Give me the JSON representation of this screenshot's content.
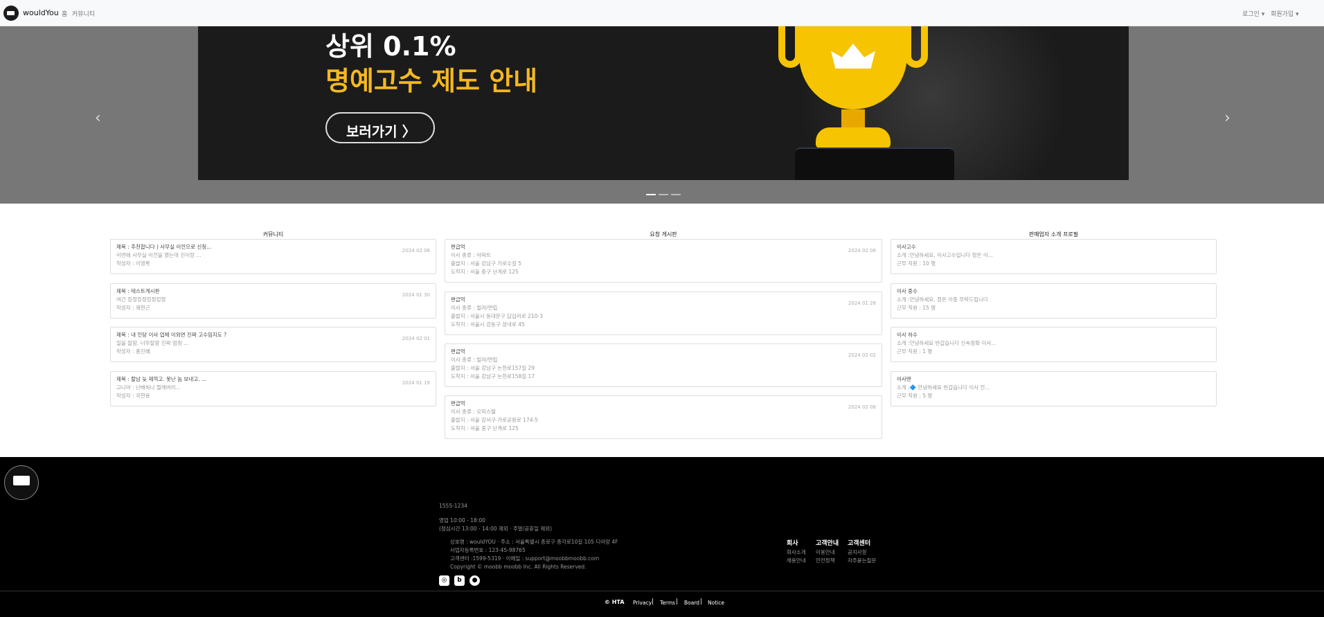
{
  "nav": {
    "brand": "wouldYou",
    "links": [
      "홈",
      "커뮤니티"
    ],
    "login": "로그인 ▾",
    "signup": "회원가입 ▾"
  },
  "carousel": {
    "line1": "상위 0.1%",
    "line2": "명예고수 제도 안내",
    "button": "보러가기  〉",
    "prev": "‹",
    "next": "›",
    "slides": 3,
    "active": 0
  },
  "community": {
    "title": "커뮤니티",
    "posts": [
      {
        "title": "제목 : 추천합니다 ) 사무실 이전으로 신청...",
        "body": "이번에 사무실 이전을 했는데 진이랑 ...",
        "author": "작성자 : 이영록",
        "date": "2024 02 08"
      },
      {
        "title": "제목 : 테스트게시판",
        "body": "여긴 킹정킹정킹정킹정",
        "author": "작성자 : 제현근",
        "date": "2024 01 30"
      },
      {
        "title": "제목 : 내 인당 이사 업체 이외면 진짜 고수임지도 ?",
        "body": "일을 잘함. 너무잘함 진짜 엄청 ...",
        "author": "작성자 : 홍진혜",
        "date": "2024 02 01"
      },
      {
        "title": "제목 : 할남 늦 제끽고. 못난 놈 보내고. ...",
        "body": "고니야 : 난배하나 필레버리...",
        "author": "작성자 : 국현용",
        "date": "2024 01 19"
      }
    ]
  },
  "requests": {
    "title": "요청 게시판",
    "items": [
      {
        "type": "편급억",
        "kind": "이사 종류 : 아파트",
        "from": "출발지 : 서울 강남구 가로수길 5",
        "to": "도착지 : 서울 중구 난계로 125",
        "date": "2024 02 06"
      },
      {
        "type": "편급억",
        "kind": "이사 종류 : 빌라/연립",
        "from": "출발지 : 서울시 동대문구 답십리로 210-3",
        "to": "도착지 : 서울시 강동구 성내로 45",
        "date": "2024 01 26"
      },
      {
        "type": "편급억",
        "kind": "이사 종류 : 빌라/연립",
        "from": "출발지 : 서울 강남구 논현로157길 29",
        "to": "도착지 : 서울 강남구 논현로158길 17",
        "date": "2024 02 02"
      },
      {
        "type": "편급억",
        "kind": "이사 종류 : 오피스텔",
        "from": "출발지 : 서울 강서구 가로공원로 174-5",
        "to": "도착지 : 서울 중구 난계로 125",
        "date": "2024 02 08"
      }
    ]
  },
  "sellers": {
    "title": "판매업자 소개 프로필",
    "items": [
      {
        "name": "이사고수",
        "intro": "소개 :안녕하세요, 이사고수입니다 정은 이...",
        "staff": "근무 직원 : 10 명"
      },
      {
        "name": "이사 중수",
        "intro": "소개 :안녕하세요, 정은 이중 무박드립니다",
        "staff": "근무 직원 : 15 명"
      },
      {
        "name": "이사 하수",
        "intro": "소개 :안녕하세요 반갑습니다 신속정확 이사...",
        "staff": "근무 직원 : 1 명"
      },
      {
        "name": "이사맨",
        "intro": "소개 :🔷 안녕하세요 반갑습니다 이사 전...",
        "staff": "근무 직원 : 5 명"
      }
    ]
  },
  "footer": {
    "phone": "1555-1234",
    "hours": "영업 10:00 - 18:00",
    "lunch": "(점심시간 13:00 - 14:00 제외 · 주말/공휴일 제외)",
    "company": "상호명 : wouldYOU · 주소 : 서울특별시 종로구 종각로10길 105 디아앙 4F",
    "bizno": "사업자등록번호 : 123-45-98765",
    "contact": "고객센터 :1599-5319 · 이메일 : support@moobbmoobb.com",
    "copyright": "Copyright © moobb moobb Inc. All Rights Reserved.",
    "col1": {
      "head": "회사",
      "links": [
        "회사소개",
        "채용안내"
      ]
    },
    "col2": {
      "head": "고객안내",
      "links": [
        "이용안내",
        "안전정책"
      ]
    },
    "col3": {
      "head": "고객센터",
      "links": [
        "공지사항",
        "자주묻는질문"
      ]
    },
    "hta": "© HTA",
    "bottom": [
      "Privacy",
      "Terms",
      "Board",
      "Notice"
    ]
  }
}
